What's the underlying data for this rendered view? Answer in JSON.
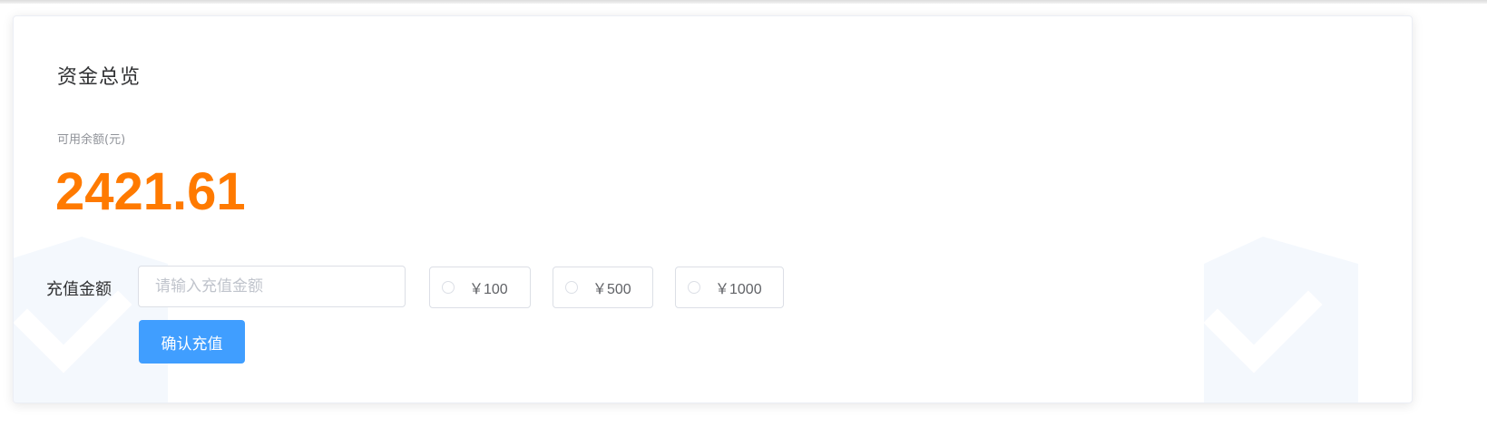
{
  "overview": {
    "title": "资金总览",
    "balance_label": "可用余额(元)",
    "balance_value": "2421.61"
  },
  "recharge": {
    "label": "充值金额",
    "input_placeholder": "请输入充值金额",
    "input_value": "",
    "options": [
      {
        "label": "￥100",
        "selected": false
      },
      {
        "label": "￥500",
        "selected": false
      },
      {
        "label": "￥1000",
        "selected": false
      }
    ],
    "confirm_label": "确认充值"
  },
  "colors": {
    "balance": "#ff7a00",
    "primary": "#409eff"
  },
  "icons": {
    "background_decoration": "shield-check-icon"
  }
}
